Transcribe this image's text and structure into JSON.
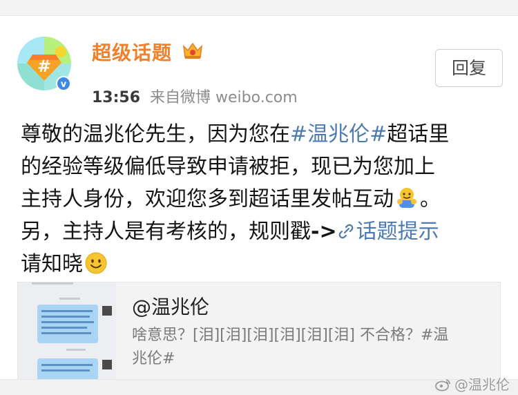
{
  "post": {
    "author": "超级话题",
    "time": "13:56",
    "source": "来自微博 weibo.com",
    "reply_label": "回复",
    "text": {
      "line1_a": "尊敬的温兆伦先生，因为您在",
      "line1_tag": "#温兆伦#",
      "line1_b": "超话里",
      "line2": "的经验等级偏低导致申请被拒，现已为您加上",
      "line3_a": "主持人身份，欢迎您多到超话里发帖互动",
      "line3_b": "。",
      "line4_a": "另，主持人是有考核的，规则戳",
      "line4_arrow": "->",
      "line4_link": "话题提示",
      "line5": "请知晓"
    },
    "embed": {
      "title": "@温兆伦",
      "desc_a": "啥意思？[泪][泪][泪][泪][泪][泪] 不合格？#温",
      "desc_b": "兆伦#"
    }
  },
  "watermark": "@温兆伦",
  "colors": {
    "author": "#f0802b",
    "hashtag": "#4b7ab3",
    "text": "#151515",
    "meta": "#8c8c8c"
  },
  "icons": {
    "avatar": "super-topic-diamond-avatar",
    "verified": "verified-badge-icon",
    "crown": "crown-icon",
    "link": "link-icon",
    "emoji_hug": "hug-emoji-icon",
    "emoji_smile": "smile-emoji-icon",
    "weibo": "weibo-logo-icon"
  }
}
